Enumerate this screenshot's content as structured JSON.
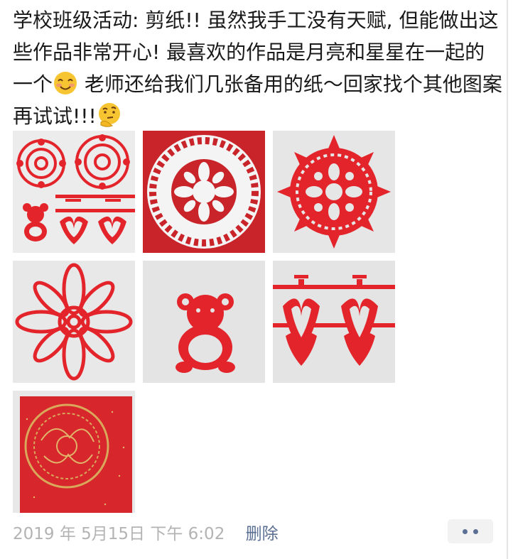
{
  "post": {
    "text_1": "学校班级活动: 剪纸!! 虽然我手工没有天赋, 但能做出这些作品非常开心! 最喜欢的作品是月亮和星星在一起的一个",
    "emoji_1": "smiling-face-emoji",
    "text_2": " 老师还给我们几张备用的纸～回家找个其他图案再试试!!!",
    "emoji_2": "thinking-face-emoji"
  },
  "photos": [
    {
      "name": "photo-paper-cut-set"
    },
    {
      "name": "photo-round-paper-cut-on-red"
    },
    {
      "name": "photo-round-paper-cut-star"
    },
    {
      "name": "photo-flower-paper-cut"
    },
    {
      "name": "photo-bear-paper-cut"
    },
    {
      "name": "photo-double-happiness-hearts"
    },
    {
      "name": "photo-gold-pattern-red-paper"
    }
  ],
  "footer": {
    "timestamp": "2019 年 5月15日 下午 6:02",
    "delete_label": "删除",
    "more_icon": "more-dots-icon"
  },
  "colors": {
    "text": "#1a1a1a",
    "meta_gray": "#b3b3b3",
    "link_blue": "#5a6f93",
    "paper_red": "#e3242b",
    "photo_bg": "#e9e9e9"
  }
}
